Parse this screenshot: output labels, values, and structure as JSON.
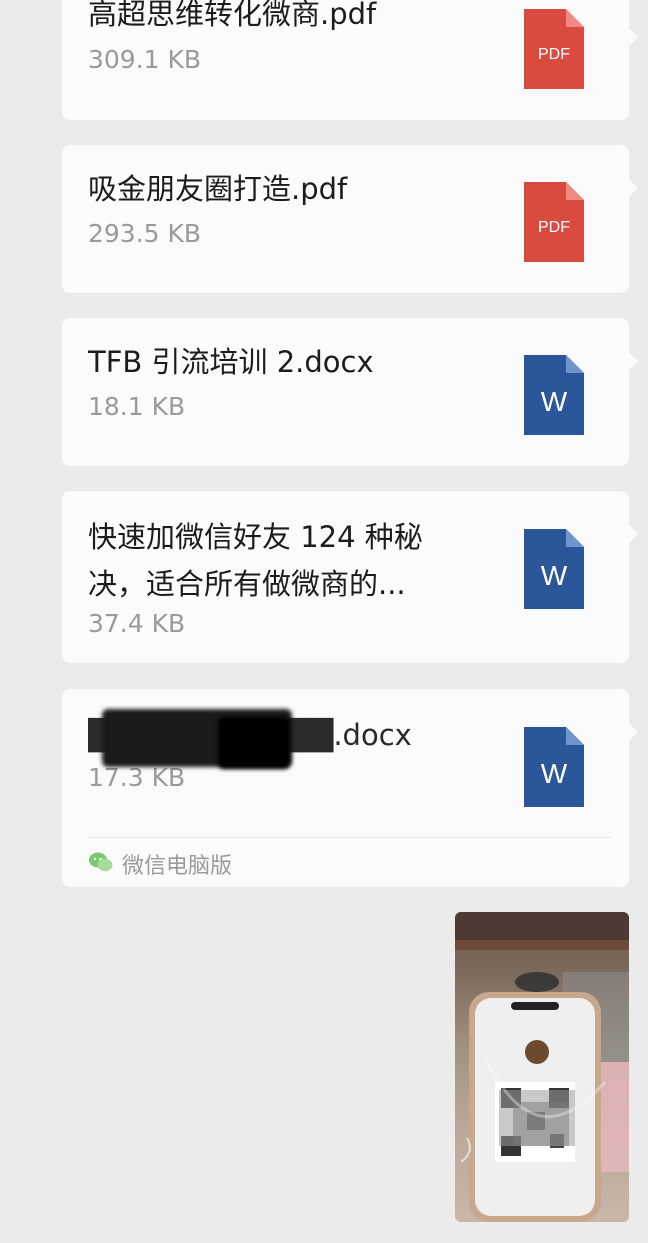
{
  "messages": [
    {
      "type": "file",
      "name": "高超思维转化微商.pdf",
      "size": "309.1 KB",
      "icon": "pdf-icon",
      "icon_label": "PDF"
    },
    {
      "type": "file",
      "name": "吸金朋友圈打造.pdf",
      "size": "293.5 KB",
      "icon": "pdf-icon",
      "icon_label": "PDF"
    },
    {
      "type": "file",
      "name": "TFB 引流培训 2.docx",
      "size": "18.1 KB",
      "icon": "word-icon",
      "icon_label": "W"
    },
    {
      "type": "file",
      "name_line1": "快速加微信好友 124 种秘",
      "name_line2": "决，适合所有做微商的...",
      "size": "37.4 KB",
      "icon": "word-icon",
      "icon_label": "W"
    },
    {
      "type": "file",
      "name": "███████████.docx",
      "name_visible": ".docx",
      "size": "17.3 KB",
      "icon": "word-icon",
      "icon_label": "W",
      "source": "微信电脑版",
      "source_icon": "wechat-icon"
    },
    {
      "type": "image",
      "description_icon": "photo-thumbnail"
    }
  ],
  "colors": {
    "background": "#ebebeb",
    "bubble": "#fbfbfb",
    "pdf": "#d94b3f",
    "word": "#2b579a",
    "wechat": "#7bc96f"
  }
}
